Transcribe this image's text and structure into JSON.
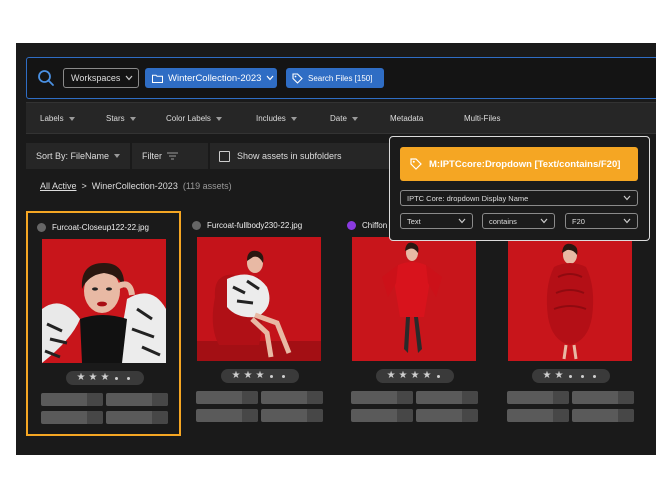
{
  "search": {
    "workspaces_label": "Workspaces",
    "collection_label": "WinterCollection-2023",
    "search_files_label": "Search Files [150]"
  },
  "filters": [
    "Labels",
    "Stars",
    "Color Labels",
    "Includes",
    "Date",
    "Metadata",
    "Multi-Files"
  ],
  "toolbar": {
    "sort_label": "Sort By: FileName",
    "filter_label": "Filter",
    "subfolders_label": "Show assets in subfolders"
  },
  "breadcrumb": {
    "root": "All Active",
    "separator": ">",
    "current": "WinerCollection-2023",
    "count": "(119 assets)"
  },
  "cards": [
    {
      "filename": "Furcoat-Closeup122-22.jpg",
      "stars": 3,
      "selected": true,
      "label_color": "#666666"
    },
    {
      "filename": "Furcoat-fullbody230-22.jpg",
      "stars": 3,
      "selected": false,
      "label_color": "#666666"
    },
    {
      "filename": "Chiffon",
      "stars": 4,
      "selected": false,
      "label_color": "#8a3ae0"
    },
    {
      "filename": "",
      "stars": 2,
      "selected": false,
      "label_color": "#666666"
    }
  ],
  "popup": {
    "tag": "M:IPTCcore:Dropdown [Text/contains/F20]",
    "field": "IPTC Core: dropdown Display Name",
    "type": "Text",
    "operator": "contains",
    "value": "F20"
  },
  "colors": {
    "accent_blue": "#2f6dc4",
    "accent_orange": "#f5a623",
    "photo_red": "#c8151b"
  }
}
